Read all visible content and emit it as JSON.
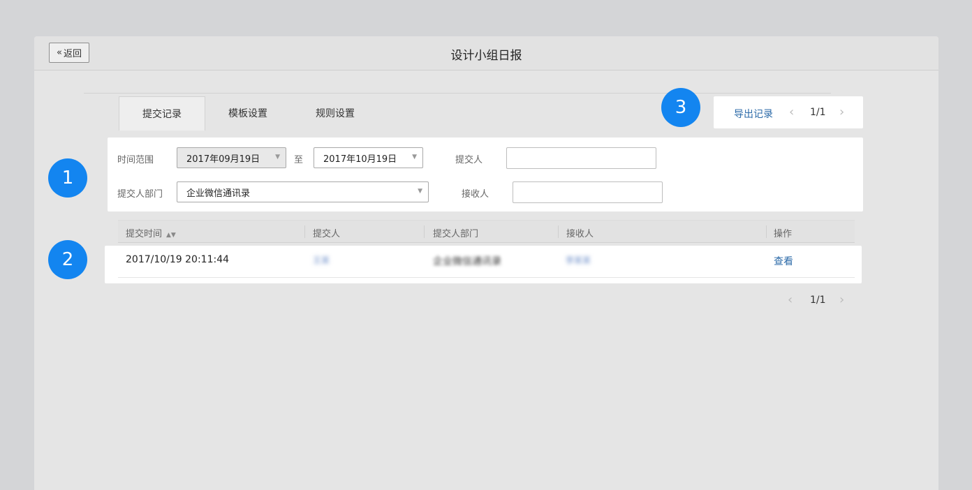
{
  "header": {
    "back_label": "返回",
    "title": "设计小组日报"
  },
  "tabs": [
    {
      "label": "提交记录",
      "active": true
    },
    {
      "label": "模板设置",
      "active": false
    },
    {
      "label": "规则设置",
      "active": false
    }
  ],
  "toolbar": {
    "export_label": "导出记录",
    "page": "1/1"
  },
  "filters": {
    "time_range_label": "时间范围",
    "date_start": "2017年09月19日",
    "to_label": "至",
    "date_end": "2017年10月19日",
    "submitter_label": "提交人",
    "submitter_value": "",
    "department_label": "提交人部门",
    "department_value": "企业微信通讯录",
    "receiver_label": "接收人",
    "receiver_value": ""
  },
  "badges": [
    "1",
    "2",
    "3"
  ],
  "table": {
    "columns": [
      "提交时间",
      "提交人",
      "提交人部门",
      "接收人",
      "操作"
    ],
    "rows": [
      {
        "time": "2017/10/19 20:11:44",
        "submitter": "王某",
        "department": "企业微信通讯录",
        "receiver": "李某某",
        "action": "查看"
      }
    ]
  },
  "bottom_pager": {
    "page": "1/1"
  },
  "colors": {
    "accent": "#1385f0",
    "link": "#2b6aa8"
  }
}
